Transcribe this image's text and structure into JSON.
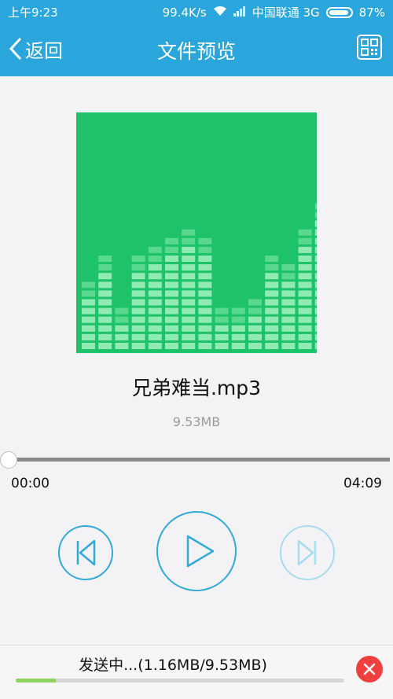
{
  "status_bar": {
    "time": "上午9:23",
    "speed": "99.4K/s",
    "carrier": "中国联通 3G",
    "battery": "87%"
  },
  "header": {
    "back_label": "返回",
    "title": "文件预览",
    "qr_icon": "qr-code-icon"
  },
  "file": {
    "name": "兄弟难当.mp3",
    "size": "9.53MB"
  },
  "player": {
    "current_time": "00:00",
    "total_time": "04:09",
    "progress": 0.0
  },
  "transfer": {
    "status_text": "发送中...(1.16MB/9.53MB)",
    "progress": 0.122
  },
  "colors": {
    "accent": "#2ba6dc",
    "cover": "#1ec26a",
    "cancel": "#ef3f3f",
    "progress_fill": "#8fd35e"
  }
}
